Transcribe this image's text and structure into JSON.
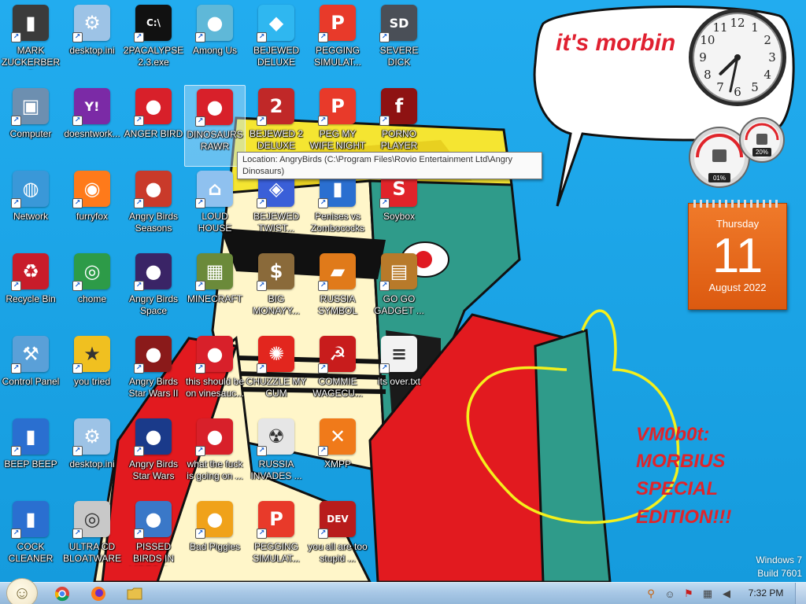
{
  "desktop": {
    "icons": [
      {
        "label": "MARK ZUCKERBERG",
        "icon": "folder-figure-icon",
        "color": "#3b3b3b",
        "sym": "▮"
      },
      {
        "label": "desktop.ini",
        "icon": "settings-file-icon",
        "color": "#9dc3e6",
        "sym": "⚙"
      },
      {
        "label": "2PACALYPSE 2.3.exe",
        "icon": "command-prompt-icon",
        "color": "#111111",
        "sym": "C:\\"
      },
      {
        "label": "Among Us",
        "icon": "among-us-icon",
        "color": "#5fb8d8",
        "sym": "●"
      },
      {
        "label": "BEJEWED DELUXE",
        "icon": "diamond-gem-icon",
        "color": "#2fb7f0",
        "sym": "◆"
      },
      {
        "label": "PEGGING SIMULAT...",
        "icon": "p-logo-icon",
        "color": "#e83a2a",
        "sym": "P"
      },
      {
        "label": "SEVERE DICK",
        "icon": "gear-sd-icon",
        "color": "#4a4f57",
        "sym": "SD"
      },
      {
        "label": "Computer",
        "icon": "computer-icon",
        "color": "#6d8fb0",
        "sym": "▣"
      },
      {
        "label": "doesntwork...",
        "icon": "yahoo-messenger-icon",
        "color": "#7b2aa6",
        "sym": "Y!"
      },
      {
        "label": "ANGER BIRD",
        "icon": "angry-bird-icon",
        "color": "#d8202a",
        "sym": "●"
      },
      {
        "label": "DINOSAURS RAWR",
        "icon": "angry-bird-icon",
        "color": "#d8202a",
        "sym": "●"
      },
      {
        "label": "BEJEWED 2 DELUXE",
        "icon": "bejeweled-2-icon",
        "color": "#c02828",
        "sym": "2"
      },
      {
        "label": "PEG MY WIFE NIGHT",
        "icon": "p-logo-icon",
        "color": "#e83a2a",
        "sym": "P"
      },
      {
        "label": "PORNO PLAYER",
        "icon": "flash-player-icon",
        "color": "#8e1212",
        "sym": "f"
      },
      {
        "label": "Network",
        "icon": "network-globe-icon",
        "color": "#3a98d8",
        "sym": "◍"
      },
      {
        "label": "furryfox",
        "icon": "firefox-icon",
        "color": "#ff7a1a",
        "sym": "◉"
      },
      {
        "label": "Angry Birds Seasons",
        "icon": "angry-birds-seasons-icon",
        "color": "#c93a2a",
        "sym": "●"
      },
      {
        "label": "LOUD HOUSE",
        "icon": "loud-house-icon",
        "color": "#8fc1ef",
        "sym": "⌂"
      },
      {
        "label": "BEJEWED TWIST...",
        "icon": "bejeweled-twist-icon",
        "color": "#3a5fd8",
        "sym": "◈"
      },
      {
        "label": "Penises vs Zombococks",
        "icon": "blue-box-icon",
        "color": "#2a6fd0",
        "sym": "▮"
      },
      {
        "label": "Soybox",
        "icon": "soybox-icon",
        "color": "#e0242a",
        "sym": "S"
      },
      {
        "label": "Recycle Bin",
        "icon": "recycle-bin-icon",
        "color": "#c81c2a",
        "sym": "♻"
      },
      {
        "label": "chome",
        "icon": "chrome-icon",
        "color": "#2d9b48",
        "sym": "◎"
      },
      {
        "label": "Angry Birds Space",
        "icon": "angry-birds-space-icon",
        "color": "#3a2466",
        "sym": "●"
      },
      {
        "label": "MINECRAFT",
        "icon": "minecraft-icon",
        "color": "#6b8a3a",
        "sym": "▦"
      },
      {
        "label": "BIG MONAYY...",
        "icon": "money-bag-icon",
        "color": "#8a6a3a",
        "sym": "$"
      },
      {
        "label": "RUSSIA SYMBOL",
        "icon": "russia-symbol-icon",
        "color": "#e07a1a",
        "sym": "▰"
      },
      {
        "label": "GO GO GADGET ...",
        "icon": "briefcase-icon",
        "color": "#b87a2a",
        "sym": "▤"
      },
      {
        "label": "Control Panel",
        "icon": "control-panel-icon",
        "color": "#5aa0d8",
        "sym": "⚒"
      },
      {
        "label": "you tried",
        "icon": "gold-star-icon",
        "color": "#f0c020",
        "sym": "★"
      },
      {
        "label": "Angry Birds Star Wars II",
        "icon": "angry-birds-star-wars-icon",
        "color": "#8a1a1a",
        "sym": "●"
      },
      {
        "label": "this should be on vinesauc...",
        "icon": "angry-bird-icon",
        "color": "#d8202a",
        "sym": "●"
      },
      {
        "label": "CHUZZLE MY CUM",
        "icon": "chuzzle-icon",
        "color": "#e2261e",
        "sym": "✺"
      },
      {
        "label": "COMMIE WAGECU...",
        "icon": "commie-emblem-icon",
        "color": "#c81c1c",
        "sym": "☭"
      },
      {
        "label": "its over.txt",
        "icon": "text-file-icon",
        "color": "#f2f2f2",
        "sym": "≡"
      },
      {
        "label": "BEEP BEEP",
        "icon": "blue-box-icon",
        "color": "#2a6fd0",
        "sym": "▮"
      },
      {
        "label": "desktop.ini",
        "icon": "settings-file-icon",
        "color": "#9dc3e6",
        "sym": "⚙"
      },
      {
        "label": "Angry Birds Star Wars",
        "icon": "angry-birds-star-wars-icon",
        "color": "#1a3a8a",
        "sym": "●"
      },
      {
        "label": "what the fuck is going on ...",
        "icon": "angry-bird-icon",
        "color": "#d8202a",
        "sym": "●"
      },
      {
        "label": "RUSSIA INVADES ...",
        "icon": "radiation-icon",
        "color": "#e6e6e6",
        "sym": "☢"
      },
      {
        "label": "XMPP",
        "icon": "xampp-icon",
        "color": "#f07a1a",
        "sym": "✕"
      },
      {
        "label": "COCK CLEANER",
        "icon": "blue-box-icon",
        "color": "#2a6fd0",
        "sym": "▮"
      },
      {
        "label": "ULTRA CD BLOATWARE",
        "icon": "cd-disc-icon",
        "color": "#c8c8c8",
        "sym": "◎"
      },
      {
        "label": "PISSED BIRDS IN VIDEO G...",
        "icon": "angry-birds-rio-icon",
        "color": "#3a78c8",
        "sym": "●"
      },
      {
        "label": "Bad Piggies",
        "icon": "bad-piggies-icon",
        "color": "#f0a21a",
        "sym": "●"
      },
      {
        "label": "PEGGING SIMULAT...",
        "icon": "p-logo-icon",
        "color": "#e83a2a",
        "sym": "P"
      },
      {
        "label": "you all are too stupid ...",
        "icon": "dev-cpp-icon",
        "color": "#b81c1c",
        "sym": "DEV"
      }
    ]
  },
  "tooltip": {
    "text": "Location: AngryBirds (C:\\Program Files\\Rovio Entertainment Ltd\\Angry Dinosaurs)"
  },
  "wallpaper": {
    "speech_bubble": "it's morbin",
    "tagline_lines": [
      "VM0b0t:",
      "MORBIUS",
      "SPECIAL",
      "EDITION!!!"
    ]
  },
  "gadgets": {
    "clock": {
      "hours": 7,
      "minutes": 32
    },
    "cpu": {
      "left_value": "01%",
      "right_value": "20%"
    },
    "calendar": {
      "day": "Thursday",
      "date": "11",
      "month": "August 2022"
    }
  },
  "os": {
    "name": "Windows 7",
    "build": "Build 7601"
  },
  "taskbar": {
    "time": "7:32 PM",
    "pinned": [
      {
        "icon": "chrome-icon",
        "color": "#2d9b48"
      },
      {
        "icon": "firefox-icon",
        "color": "#ff7a1a"
      },
      {
        "icon": "folder-icon",
        "color": "#e8c04a"
      }
    ],
    "tray": [
      {
        "icon": "search-magnifier-icon",
        "sym": "⚲",
        "color": "#c8600a"
      },
      {
        "icon": "chat-icon",
        "sym": "☺",
        "color": "#444444"
      },
      {
        "icon": "action-center-flag-icon",
        "sym": "⚑",
        "color": "#c81c1c"
      },
      {
        "icon": "network-icon",
        "sym": "▦",
        "color": "#444444"
      },
      {
        "icon": "volume-icon",
        "sym": "◀",
        "color": "#444444"
      }
    ]
  }
}
